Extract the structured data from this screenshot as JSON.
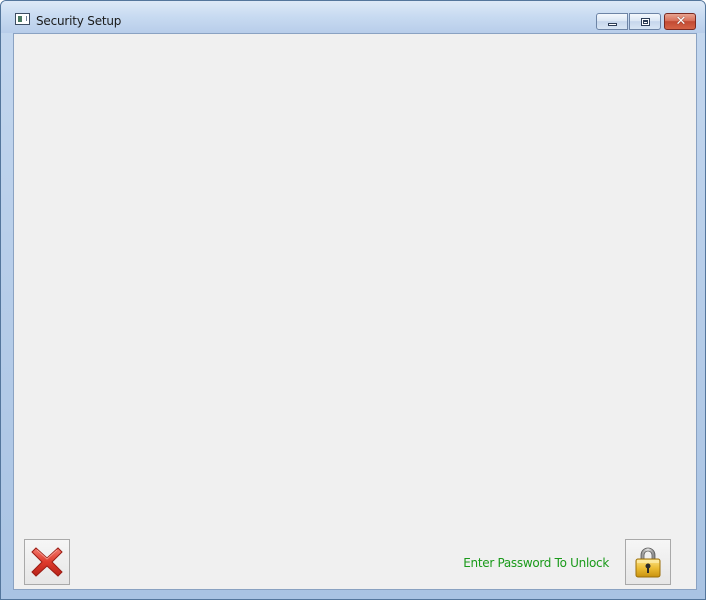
{
  "window": {
    "title": "Security Setup",
    "app_icon": "app-window-icon",
    "caption_buttons": {
      "minimize_icon": "minimize-icon",
      "maximize_icon": "maximize-icon",
      "close_icon": "close-icon",
      "close_glyph": "✕"
    }
  },
  "footer": {
    "cancel_icon": "red-x-icon",
    "status_text": "Enter Password To Unlock",
    "status_color": "#1a9a1a",
    "unlock_icon": "padlock-icon"
  },
  "colors": {
    "accent_close": "#c24a33",
    "client_background": "#f0f0f0",
    "lock_gold": "#e8b830"
  }
}
